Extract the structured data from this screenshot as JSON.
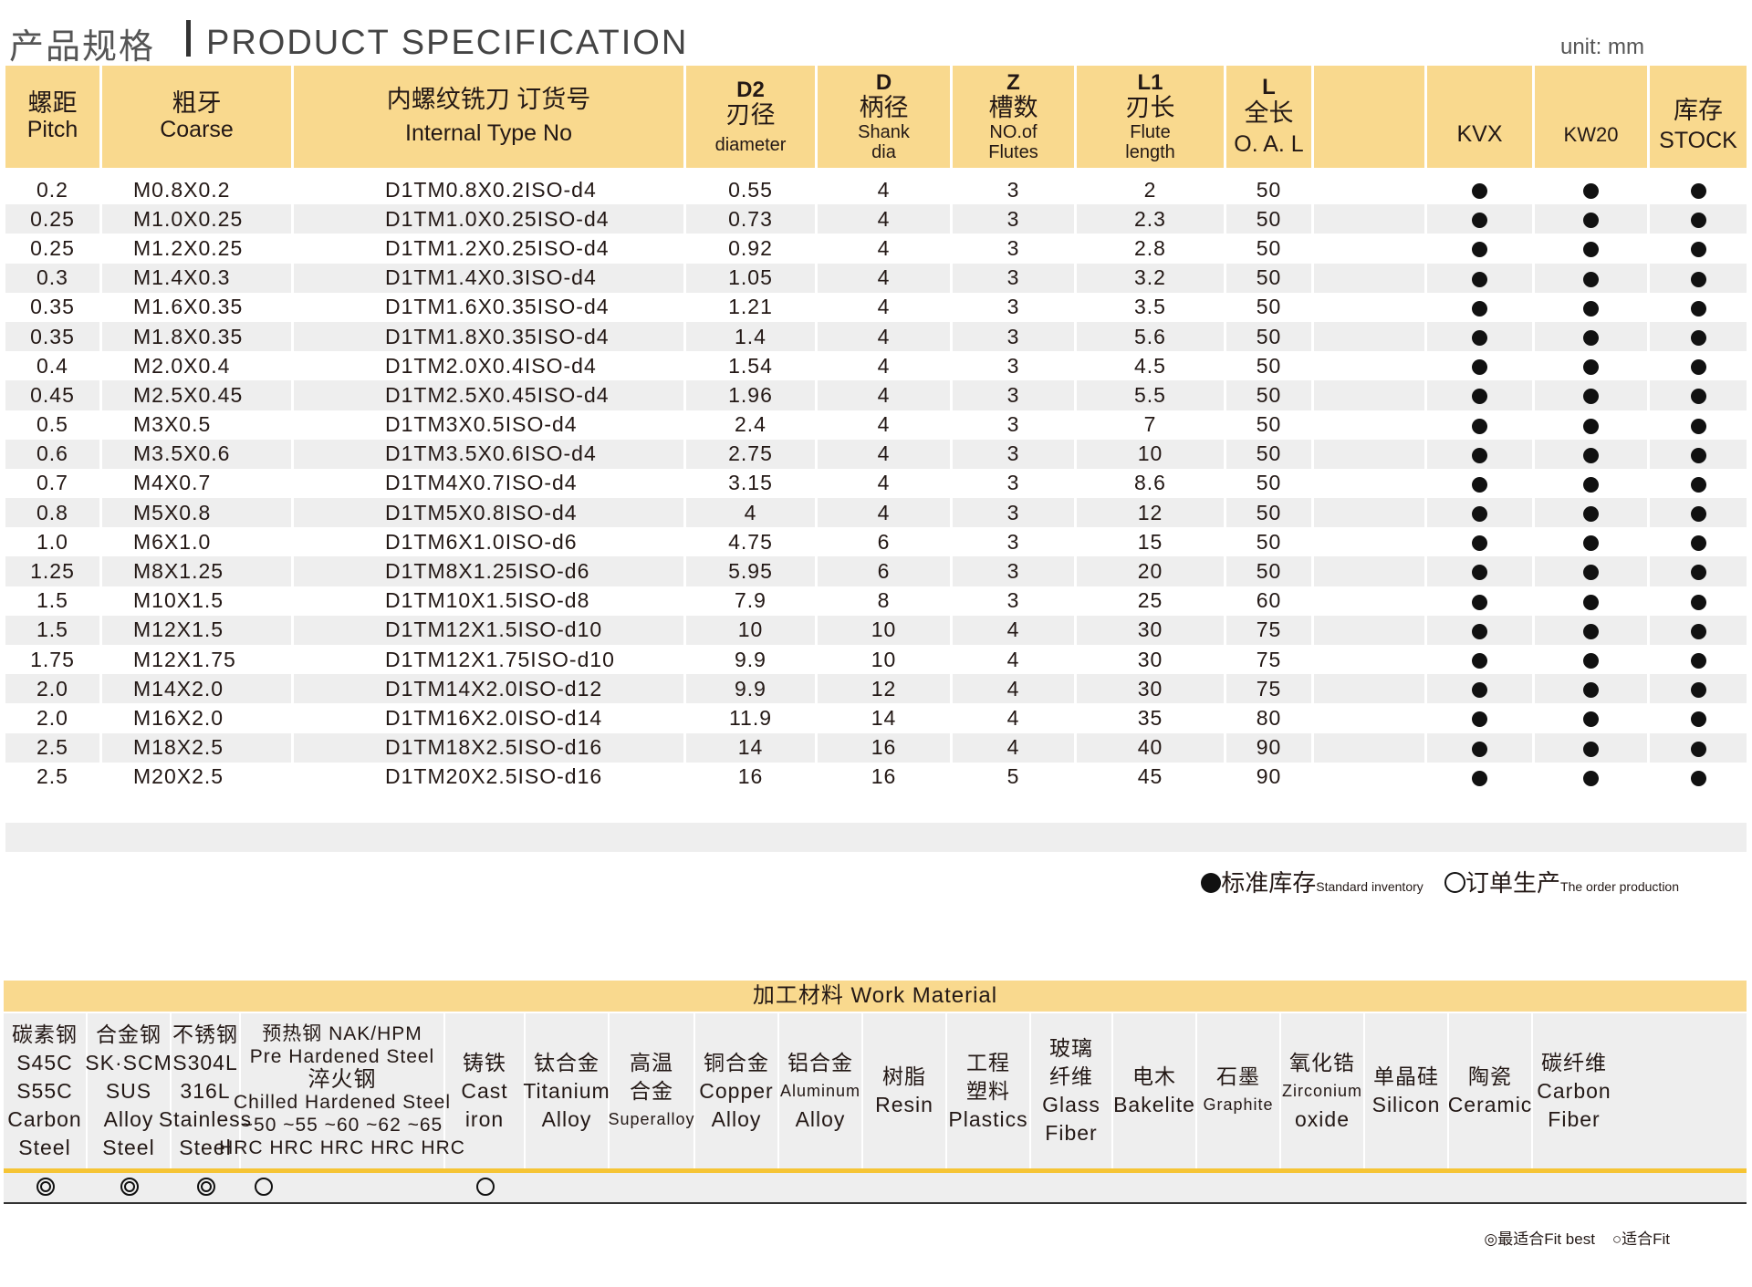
{
  "header": {
    "title_cn": "产品规格",
    "title_en": "PRODUCT SPECIFICATION",
    "unit": "unit: mm"
  },
  "columns": {
    "pitch": {
      "cn": "螺距",
      "en": "Pitch"
    },
    "coarse": {
      "cn": "粗牙",
      "en": "Coarse"
    },
    "order": {
      "cn": "内螺纹铣刀 订货号",
      "en": "Internal  Type  No"
    },
    "d2": {
      "code": "D2",
      "cn": "刃径",
      "en": "diameter"
    },
    "d": {
      "code": "D",
      "cn": "柄径",
      "en": "Shank dia"
    },
    "z": {
      "code": "Z",
      "cn": "槽数",
      "en1": "NO.of",
      "en2": "Flutes"
    },
    "l1": {
      "code": "L1",
      "cn": "刃长",
      "en1": "Flute",
      "en2": "length"
    },
    "l": {
      "code": "L",
      "cn": "全长",
      "en": "O. A. L"
    },
    "blank": "",
    "kvx": "KVX",
    "kw20": "KW20",
    "stock": {
      "cn": "库存",
      "en": "STOCK"
    }
  },
  "rows": [
    {
      "pitch": "0.2",
      "coarse": "M0.8X0.2",
      "order": "D1TM0.8X0.2ISO-d4",
      "d2": "0.55",
      "d": "4",
      "z": "3",
      "l1": "2",
      "l": "50"
    },
    {
      "pitch": "0.25",
      "coarse": "M1.0X0.25",
      "order": "D1TM1.0X0.25ISO-d4",
      "d2": "0.73",
      "d": "4",
      "z": "3",
      "l1": "2.3",
      "l": "50"
    },
    {
      "pitch": "0.25",
      "coarse": "M1.2X0.25",
      "order": "D1TM1.2X0.25ISO-d4",
      "d2": "0.92",
      "d": "4",
      "z": "3",
      "l1": "2.8",
      "l": "50"
    },
    {
      "pitch": "0.3",
      "coarse": "M1.4X0.3",
      "order": "D1TM1.4X0.3ISO-d4",
      "d2": "1.05",
      "d": "4",
      "z": "3",
      "l1": "3.2",
      "l": "50"
    },
    {
      "pitch": "0.35",
      "coarse": "M1.6X0.35",
      "order": "D1TM1.6X0.35ISO-d4",
      "d2": "1.21",
      "d": "4",
      "z": "3",
      "l1": "3.5",
      "l": "50"
    },
    {
      "pitch": "0.35",
      "coarse": "M1.8X0.35",
      "order": "D1TM1.8X0.35ISO-d4",
      "d2": "1.4",
      "d": "4",
      "z": "3",
      "l1": "5.6",
      "l": "50"
    },
    {
      "pitch": "0.4",
      "coarse": "M2.0X0.4",
      "order": "D1TM2.0X0.4ISO-d4",
      "d2": "1.54",
      "d": "4",
      "z": "3",
      "l1": "4.5",
      "l": "50"
    },
    {
      "pitch": "0.45",
      "coarse": "M2.5X0.45",
      "order": "D1TM2.5X0.45ISO-d4",
      "d2": "1.96",
      "d": "4",
      "z": "3",
      "l1": "5.5",
      "l": "50"
    },
    {
      "pitch": "0.5",
      "coarse": "M3X0.5",
      "order": "D1TM3X0.5ISO-d4",
      "d2": "2.4",
      "d": "4",
      "z": "3",
      "l1": "7",
      "l": "50"
    },
    {
      "pitch": "0.6",
      "coarse": "M3.5X0.6",
      "order": "D1TM3.5X0.6ISO-d4",
      "d2": "2.75",
      "d": "4",
      "z": "3",
      "l1": "10",
      "l": "50"
    },
    {
      "pitch": "0.7",
      "coarse": "M4X0.7",
      "order": "D1TM4X0.7ISO-d4",
      "d2": "3.15",
      "d": "4",
      "z": "3",
      "l1": "8.6",
      "l": "50"
    },
    {
      "pitch": "0.8",
      "coarse": "M5X0.8",
      "order": "D1TM5X0.8ISO-d4",
      "d2": "4",
      "d": "4",
      "z": "3",
      "l1": "12",
      "l": "50"
    },
    {
      "pitch": "1.0",
      "coarse": "M6X1.0",
      "order": "D1TM6X1.0ISO-d6",
      "d2": "4.75",
      "d": "6",
      "z": "3",
      "l1": "15",
      "l": "50"
    },
    {
      "pitch": "1.25",
      "coarse": "M8X1.25",
      "order": "D1TM8X1.25ISO-d6",
      "d2": "5.95",
      "d": "6",
      "z": "3",
      "l1": "20",
      "l": "50"
    },
    {
      "pitch": "1.5",
      "coarse": "M10X1.5",
      "order": "D1TM10X1.5ISO-d8",
      "d2": "7.9",
      "d": "8",
      "z": "3",
      "l1": "25",
      "l": "60"
    },
    {
      "pitch": "1.5",
      "coarse": "M12X1.5",
      "order": "D1TM12X1.5ISO-d10",
      "d2": "10",
      "d": "10",
      "z": "4",
      "l1": "30",
      "l": "75"
    },
    {
      "pitch": "1.75",
      "coarse": "M12X1.75",
      "order": "D1TM12X1.75ISO-d10",
      "d2": "9.9",
      "d": "10",
      "z": "4",
      "l1": "30",
      "l": "75"
    },
    {
      "pitch": "2.0",
      "coarse": "M14X2.0",
      "order": "D1TM14X2.0ISO-d12",
      "d2": "9.9",
      "d": "12",
      "z": "4",
      "l1": "30",
      "l": "75"
    },
    {
      "pitch": "2.0",
      "coarse": "M16X2.0",
      "order": "D1TM16X2.0ISO-d14",
      "d2": "11.9",
      "d": "14",
      "z": "4",
      "l1": "35",
      "l": "80"
    },
    {
      "pitch": "2.5",
      "coarse": "M18X2.5",
      "order": "D1TM18X2.5ISO-d16",
      "d2": "14",
      "d": "16",
      "z": "4",
      "l1": "40",
      "l": "90"
    },
    {
      "pitch": "2.5",
      "coarse": "M20X2.5",
      "order": "D1TM20X2.5ISO-d16",
      "d2": "16",
      "d": "16",
      "z": "5",
      "l1": "45",
      "l": "90"
    }
  ],
  "availability_marks": {
    "kvx": "standard",
    "kw20": "standard",
    "stock": "standard"
  },
  "legend": {
    "standard_cn": "标准库存",
    "standard_en": "Standard inventory",
    "order_cn": "订单生产",
    "order_en": "The order production"
  },
  "materials": {
    "title": "加工材料 Work Material",
    "columns": [
      {
        "lines": [
          "碳素钢",
          "S45C",
          "S55C",
          "Carbon",
          "Steel"
        ],
        "mark": "best"
      },
      {
        "lines": [
          "合金钢",
          "SK·SCM",
          "SUS",
          "Alloy",
          "Steel"
        ],
        "mark": "best"
      },
      {
        "lines": [
          "不锈钢",
          "S304L",
          "316L",
          "Stainless",
          "Steel"
        ],
        "mark": "best"
      },
      {
        "lines": [
          "预热钢 NAK/HPM",
          "Pre Hardened Steel",
          "淬火钢",
          "Chilled Hardened Steel",
          "~50  ~55  ~60  ~62  ~65",
          "HRC HRC HRC HRC HRC"
        ],
        "mark": "fit"
      },
      {
        "lines": [
          "铸铁",
          "Cast",
          "iron"
        ],
        "mark": "fit"
      },
      {
        "lines": [
          "钛合金",
          "Titanium",
          "Alloy"
        ],
        "mark": ""
      },
      {
        "lines": [
          "高温",
          "合金",
          "Superalloy"
        ],
        "mark": ""
      },
      {
        "lines": [
          "铜合金",
          "Copper",
          "Alloy"
        ],
        "mark": ""
      },
      {
        "lines": [
          "铝合金",
          "Aluminum",
          "Alloy"
        ],
        "mark": ""
      },
      {
        "lines": [
          "树脂",
          "Resin"
        ],
        "mark": ""
      },
      {
        "lines": [
          "工程",
          "塑料",
          "Plastics"
        ],
        "mark": ""
      },
      {
        "lines": [
          "玻璃",
          "纤维",
          "Glass",
          "Fiber"
        ],
        "mark": ""
      },
      {
        "lines": [
          "电木",
          "Bakelite"
        ],
        "mark": ""
      },
      {
        "lines": [
          "石墨",
          "Graphite"
        ],
        "mark": ""
      },
      {
        "lines": [
          "氧化锆",
          "Zirconium",
          "oxide"
        ],
        "mark": ""
      },
      {
        "lines": [
          "单晶硅",
          "Silicon"
        ],
        "mark": ""
      },
      {
        "lines": [
          "陶瓷",
          "Ceramic"
        ],
        "mark": ""
      },
      {
        "lines": [
          "碳纤维",
          "Carbon",
          "Fiber"
        ],
        "mark": ""
      }
    ]
  },
  "fit_legend": {
    "best": "◎最适合Fit best",
    "fit": "○适合Fit"
  },
  "colors": {
    "header_bg": "#f9d98e",
    "accent_line": "#f5c435",
    "row_alt": "#eeeeee"
  }
}
